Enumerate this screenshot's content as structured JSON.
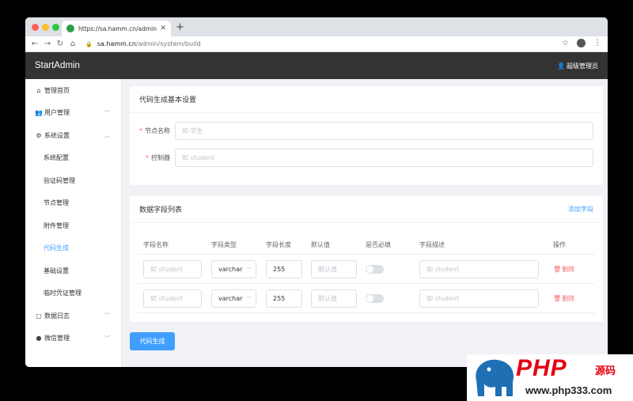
{
  "browser": {
    "tab_title": "https://sa.hamm.cn/admin/syste",
    "tab_close": "✕",
    "new_tab": "+",
    "url_host": "sa.hamm.cn",
    "url_path": "/admin/system/build"
  },
  "header": {
    "brand": "StartAdmin",
    "user": "超级管理员"
  },
  "sidebar": {
    "items": [
      {
        "label": "管理首页",
        "icon": "home-icon",
        "glyph": "⌂"
      },
      {
        "label": "用户管理",
        "icon": "users-icon",
        "glyph": "👥",
        "chevron": "﹀"
      },
      {
        "label": "系统设置",
        "icon": "gear-icon",
        "glyph": "⚙",
        "chevron": "︿"
      },
      {
        "label": "系统配置"
      },
      {
        "label": "验证码管理"
      },
      {
        "label": "节点管理"
      },
      {
        "label": "附件管理"
      },
      {
        "label": "代码生成",
        "active": true
      },
      {
        "label": "基础设置"
      },
      {
        "label": "临时凭证管理"
      },
      {
        "label": "数据日志",
        "icon": "document-icon",
        "glyph": "▢",
        "chevron": "﹀"
      },
      {
        "label": "微信管理",
        "icon": "wechat-icon",
        "glyph": "●",
        "chevron": "﹀"
      }
    ]
  },
  "basic": {
    "title": "代码生成基本设置",
    "node_label": "节点名称",
    "node_placeholder": "如 学生",
    "controller_label": "控制器",
    "controller_placeholder": "如 student"
  },
  "fields": {
    "title": "数据字段列表",
    "add_label": "添加字段",
    "columns": [
      "字段名称",
      "字段类型",
      "字段长度",
      "默认值",
      "是否必填",
      "字段描述",
      "操作"
    ],
    "rows": [
      {
        "name_placeholder": "如 student",
        "type": "varchar",
        "length": "255",
        "default_placeholder": "默认值",
        "desc_placeholder": "如 student",
        "delete_label": "删除"
      },
      {
        "name_placeholder": "如 student",
        "type": "varchar",
        "length": "255",
        "default_placeholder": "默认值",
        "desc_placeholder": "如 student",
        "delete_label": "删除"
      }
    ]
  },
  "actions": {
    "generate_label": "代码生成"
  },
  "watermark": {
    "brand": "PHP",
    "cn": "源码",
    "url": "www.php333.com"
  },
  "colors": {
    "primary": "#409eff",
    "danger": "#f56c6c",
    "header_bg": "#333333"
  }
}
